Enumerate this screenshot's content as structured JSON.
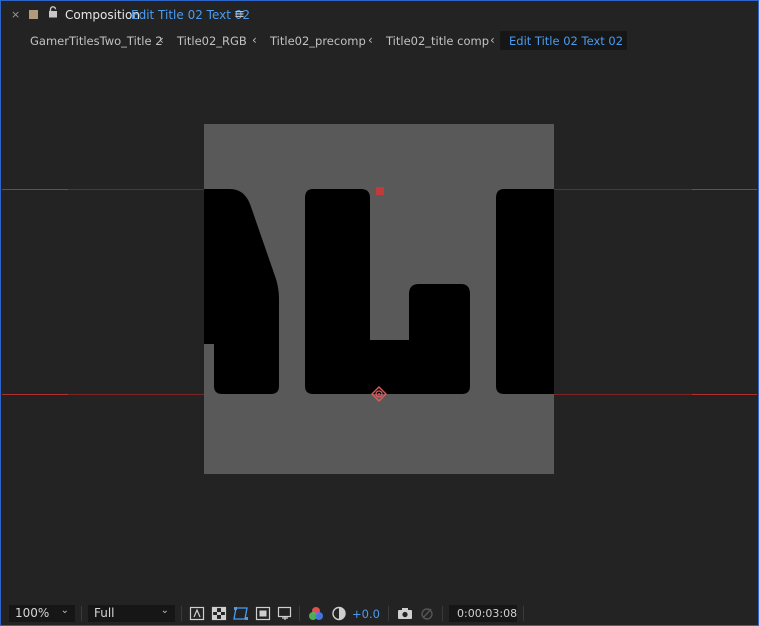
{
  "panel": {
    "close_glyph": "×",
    "label": "Composition",
    "comp_name": "Edit Title 02 Text 02",
    "menu_glyph": "≡",
    "label_color": "#b39a7c",
    "accent_color": "#4a9cf0"
  },
  "breadcrumb": {
    "items": [
      "GamerTitlesTwo_Title 2",
      "Title02_RGB",
      "Title02_precomp",
      "Title02_title comp",
      "Edit Title 02 Text 02"
    ],
    "separator": "‹"
  },
  "viewer": {
    "background": "#595959",
    "guide_color": "#b12f2f",
    "text_fill": "#000000"
  },
  "toolbar": {
    "magnification": "100%",
    "resolution": "Full",
    "exposure": "+0.0",
    "timecode": "0:00:03:08",
    "icons": [
      "snapshot-region-icon",
      "transparency-grid-icon",
      "mask-path-visibility-icon",
      "safe-margins-icon",
      "region-of-interest-icon",
      "color-channels-icon",
      "reset-exposure-icon",
      "take-snapshot-icon",
      "show-snapshot-icon"
    ]
  }
}
